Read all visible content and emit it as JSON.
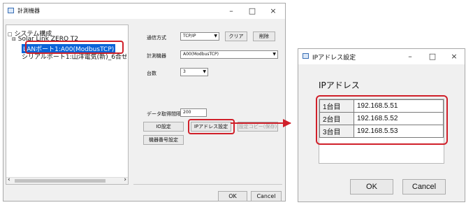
{
  "left_window": {
    "title": "計測機器",
    "controls": {
      "minimize": "–",
      "maximize": "□",
      "close": "×"
    },
    "tree": {
      "root": "システム構成",
      "device": "Solar Link ZERO T2",
      "lan_port": "LANポート1:A00(ModbusTCP)",
      "serial_port": "シリアルポート1:山洋電気(新)_6合せ"
    },
    "scroll_left": "‹",
    "scroll_right": "›",
    "settings": {
      "comm_label": "通信方式",
      "comm_value": "TCP/IP",
      "clear_button": "クリア",
      "delete_button": "削除",
      "device_label": "計測機器",
      "device_value": "A00(ModbusTCP)",
      "units_label": "台数",
      "units_value": "3",
      "timeout_label": "データ取得間隔",
      "timeout_value": "200",
      "io_setting_button": "IO設定",
      "ip_setting_button": "IPアドレス設定",
      "disabled_button": "設定コピー(保存)",
      "device_number_button": "機器番号設定"
    },
    "ok_button": "OK",
    "cancel_button": "Cancel"
  },
  "ip_dialog": {
    "title": "IPアドレス設定",
    "controls": {
      "minimize": "–",
      "maximize": "□",
      "close": "×"
    },
    "heading": "IPアドレス",
    "rows": [
      {
        "label": "1台目",
        "ip": "192.168.5.51"
      },
      {
        "label": "2台目",
        "ip": "192.168.5.52"
      },
      {
        "label": "3台目",
        "ip": "192.168.5.53"
      }
    ],
    "ok_button": "OK",
    "cancel_button": "Cancel"
  },
  "colors": {
    "highlight_red": "#d0202a",
    "selection_blue": "#0a63d8"
  }
}
